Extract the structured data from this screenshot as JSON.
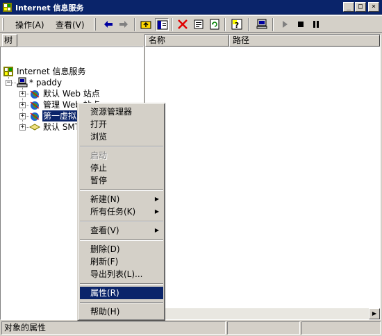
{
  "window": {
    "title": "Internet 信息服务",
    "min_glyph": "_",
    "max_glyph": "□",
    "close_glyph": "×"
  },
  "menubar": {
    "action": "操作(A)",
    "view": "查看(V)"
  },
  "toolbar_icons": [
    "back-arrow-icon",
    "forward-arrow-icon",
    "up-folder-icon",
    "show-hide-tree-icon",
    "delete-icon",
    "properties-icon",
    "refresh-icon",
    "help-icon",
    "computer-icon",
    "start-icon",
    "stop-icon",
    "pause-icon"
  ],
  "tree": {
    "tab_label": "树",
    "root": "Internet 信息服务",
    "server": "* paddy",
    "items": [
      "默认 Web 站点",
      "管理 Web 站点",
      "第一虚拟主机",
      "默认 SMTP"
    ]
  },
  "list": {
    "col_name": "名称",
    "col_path": "路径"
  },
  "status": {
    "text": "对象的属性"
  },
  "context_menu": {
    "items": [
      {
        "label": "资源管理器",
        "state": "normal"
      },
      {
        "label": "打开",
        "state": "normal"
      },
      {
        "label": "浏览",
        "state": "normal"
      },
      {
        "label": "启动",
        "state": "disabled"
      },
      {
        "label": "停止",
        "state": "normal"
      },
      {
        "label": "暂停",
        "state": "normal"
      },
      {
        "label": "新建(N)",
        "state": "submenu"
      },
      {
        "label": "所有任务(K)",
        "state": "submenu"
      },
      {
        "label": "查看(V)",
        "state": "submenu"
      },
      {
        "label": "删除(D)",
        "state": "normal"
      },
      {
        "label": "刷新(F)",
        "state": "normal"
      },
      {
        "label": "导出列表(L)...",
        "state": "normal"
      },
      {
        "label": "属性(R)",
        "state": "highlighted"
      },
      {
        "label": "帮助(H)",
        "state": "normal"
      }
    ],
    "submenu_arrow": "▶"
  },
  "colors": {
    "title_bar": "#0a246a",
    "face": "#d4d0c8",
    "highlight": "#0a246a"
  }
}
